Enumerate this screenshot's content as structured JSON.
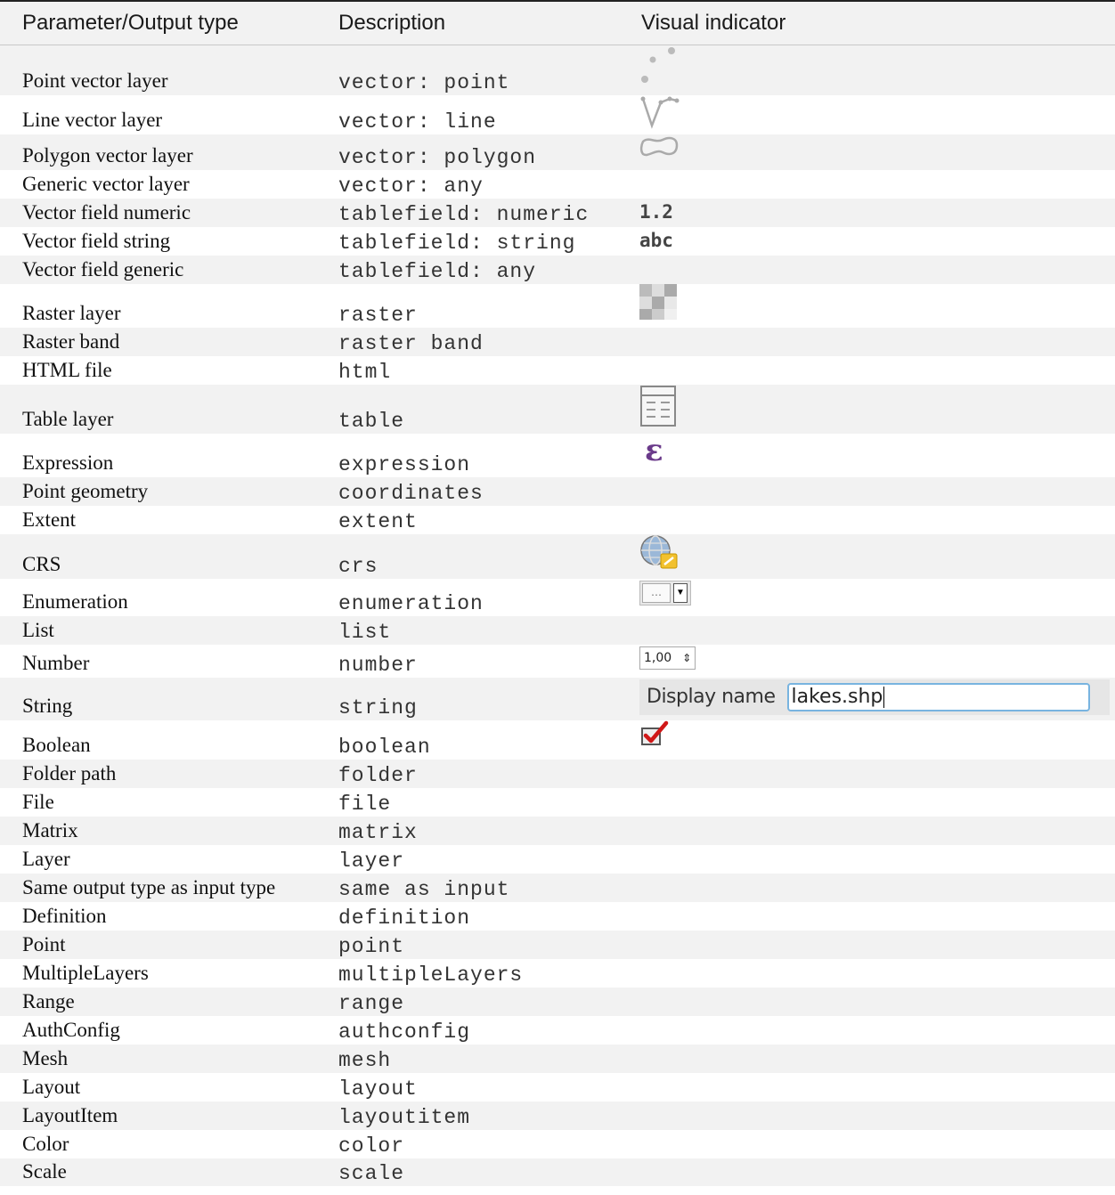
{
  "header": {
    "col1": "Parameter/Output type",
    "col2": "Description",
    "col3": "Visual indicator"
  },
  "rows": [
    {
      "name": "Point vector layer",
      "desc": "vector: point",
      "icon": "point-vector-icon"
    },
    {
      "name": "Line vector layer",
      "desc": "vector: line",
      "icon": "line-vector-icon"
    },
    {
      "name": "Polygon vector layer",
      "desc": "vector: polygon",
      "icon": "polygon-vector-icon"
    },
    {
      "name": "Generic vector layer",
      "desc": "vector: any",
      "icon": ""
    },
    {
      "name": "Vector field numeric",
      "desc": "tablefield: numeric",
      "icon": "numeric-field-icon",
      "vis_text": "1.2"
    },
    {
      "name": "Vector field string",
      "desc": "tablefield: string",
      "icon": "string-field-icon",
      "vis_text": "abc"
    },
    {
      "name": "Vector field generic",
      "desc": "tablefield: any",
      "icon": ""
    },
    {
      "name": "Raster layer",
      "desc": "raster",
      "icon": "raster-icon"
    },
    {
      "name": "Raster band",
      "desc": "raster band",
      "icon": ""
    },
    {
      "name": "HTML file",
      "desc": "html",
      "icon": ""
    },
    {
      "name": "Table layer",
      "desc": "table",
      "icon": "table-icon"
    },
    {
      "name": "Expression",
      "desc": "expression",
      "icon": "expression-icon"
    },
    {
      "name": "Point geometry",
      "desc": "coordinates",
      "icon": ""
    },
    {
      "name": "Extent",
      "desc": "extent",
      "icon": ""
    },
    {
      "name": "CRS",
      "desc": "crs",
      "icon": "crs-globe-icon"
    },
    {
      "name": "Enumeration",
      "desc": "enumeration",
      "icon": "combobox-icon"
    },
    {
      "name": "List",
      "desc": "list",
      "icon": ""
    },
    {
      "name": "Number",
      "desc": "number",
      "icon": "spinbox-icon",
      "spin_value": "1,00"
    },
    {
      "name": "String",
      "desc": "string",
      "icon": "string-widget",
      "str_label": "Display name",
      "str_value": "lakes.shp"
    },
    {
      "name": "Boolean",
      "desc": "boolean",
      "icon": "checkbox-icon"
    },
    {
      "name": "Folder path",
      "desc": "folder",
      "icon": ""
    },
    {
      "name": "File",
      "desc": "file",
      "icon": ""
    },
    {
      "name": "Matrix",
      "desc": "matrix",
      "icon": ""
    },
    {
      "name": "Layer",
      "desc": "layer",
      "icon": ""
    },
    {
      "name": "Same output type as input type",
      "desc": "same as input",
      "icon": ""
    },
    {
      "name": "Definition",
      "desc": "definition",
      "icon": ""
    },
    {
      "name": "Point",
      "desc": "point",
      "icon": ""
    },
    {
      "name": "MultipleLayers",
      "desc": "multipleLayers",
      "icon": ""
    },
    {
      "name": "Range",
      "desc": "range",
      "icon": ""
    },
    {
      "name": "AuthConfig",
      "desc": "authconfig",
      "icon": ""
    },
    {
      "name": "Mesh",
      "desc": "mesh",
      "icon": ""
    },
    {
      "name": "Layout",
      "desc": "layout",
      "icon": ""
    },
    {
      "name": "LayoutItem",
      "desc": "layoutitem",
      "icon": ""
    },
    {
      "name": "Color",
      "desc": "color",
      "icon": ""
    },
    {
      "name": "Scale",
      "desc": "scale",
      "icon": ""
    }
  ]
}
